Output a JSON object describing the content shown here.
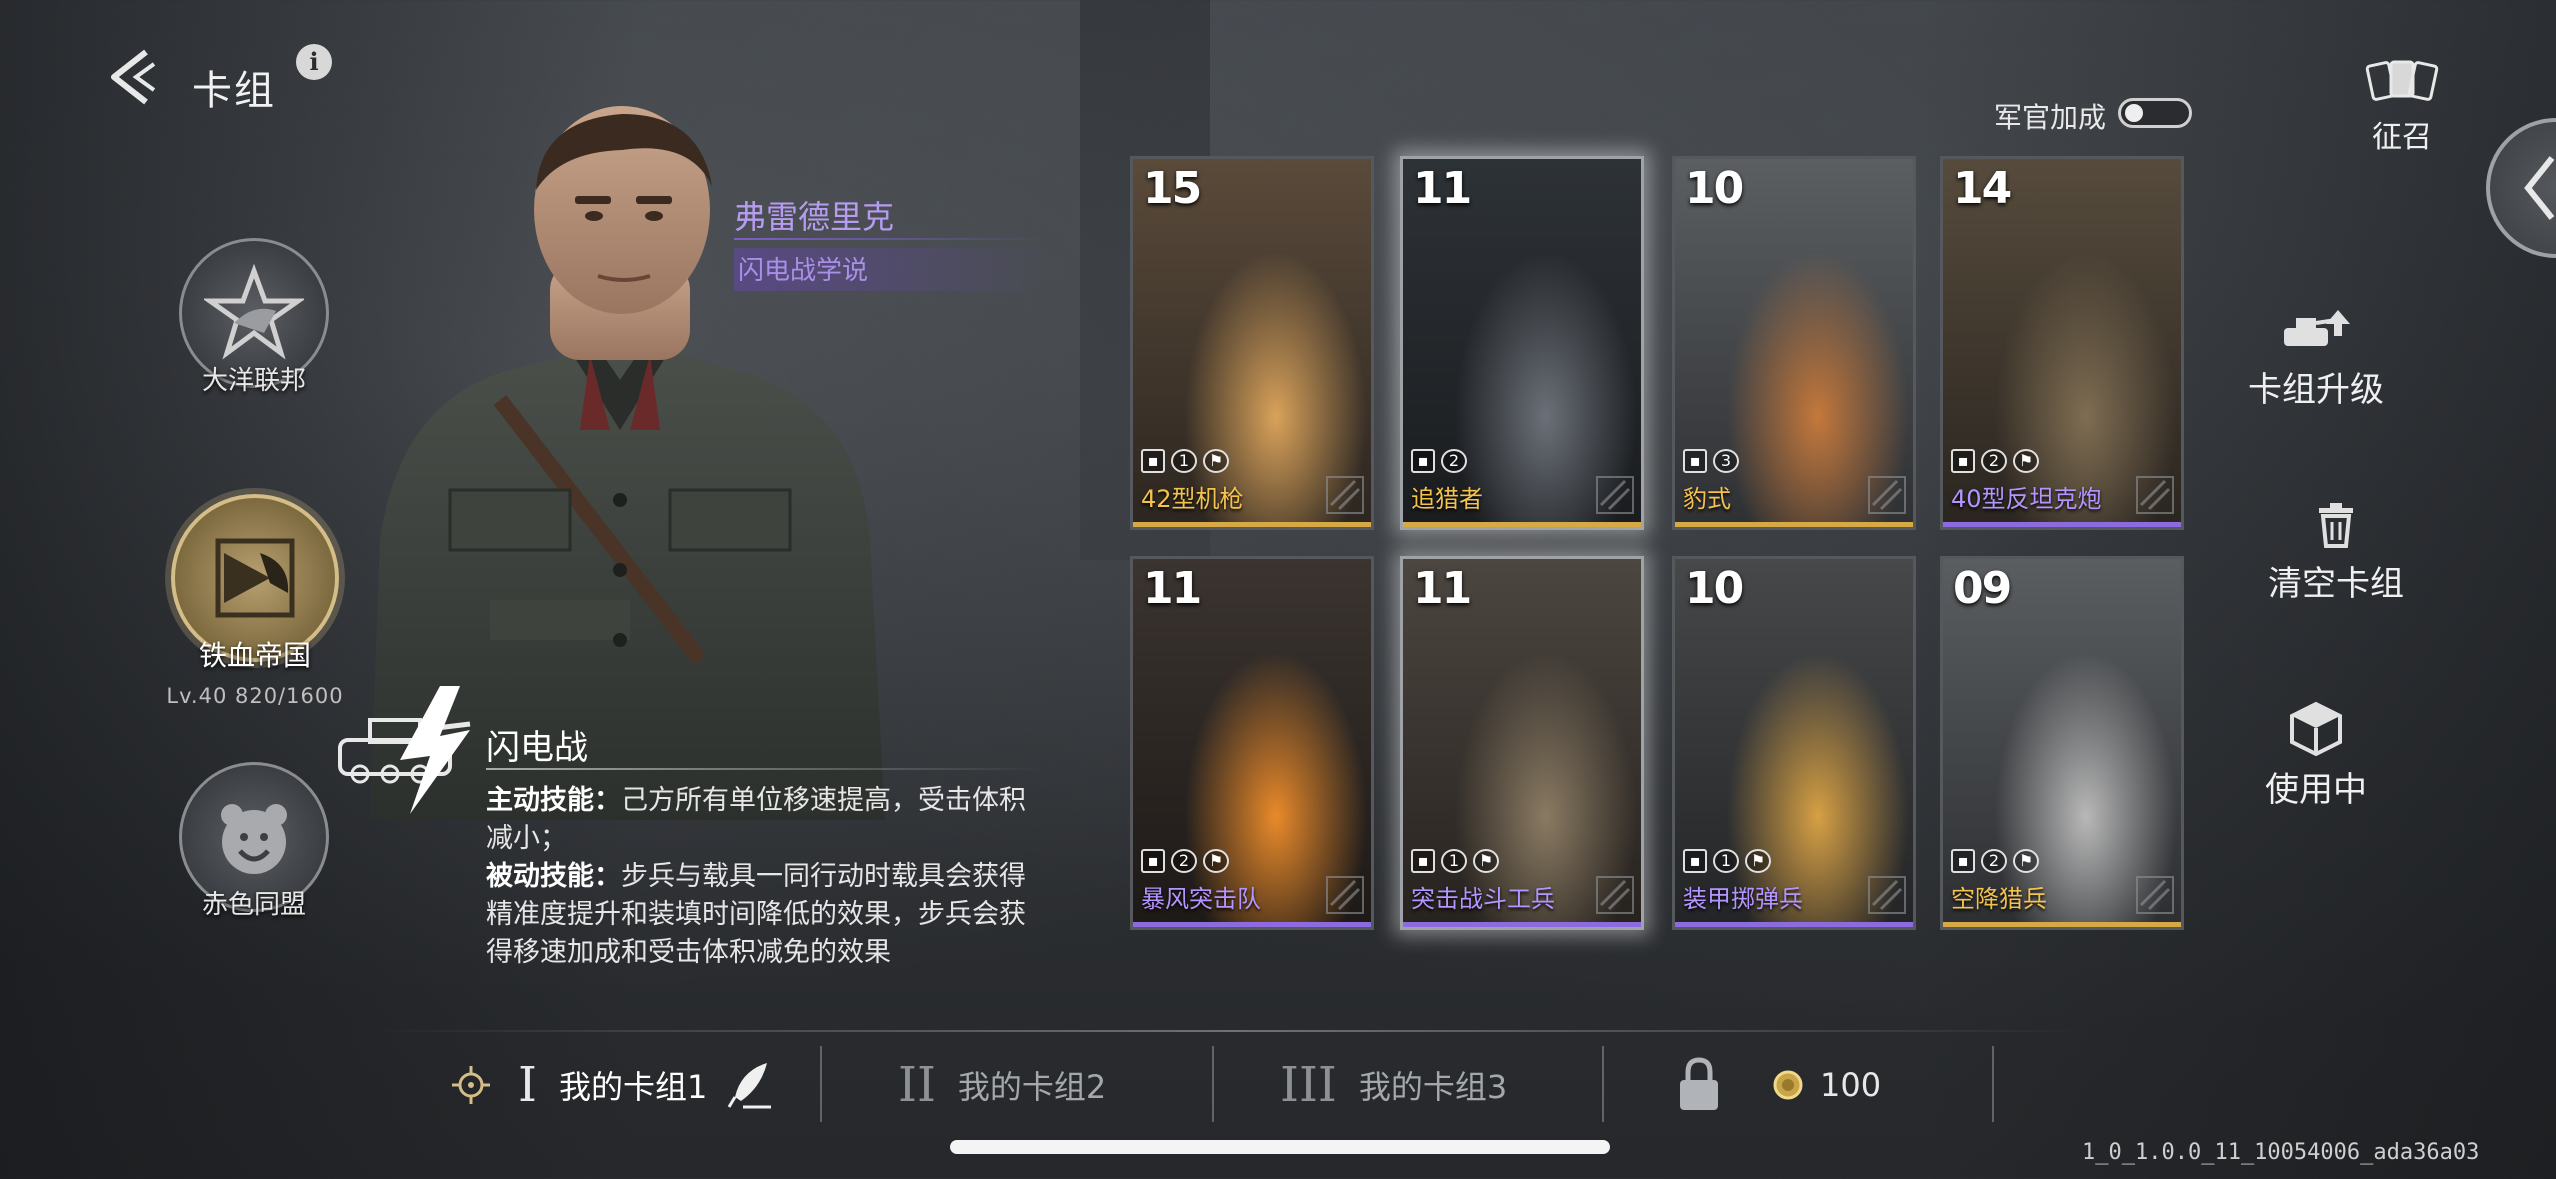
{
  "header": {
    "title": "卡组",
    "info_icon": "info-icon",
    "back_icon": "back-arrow-icon"
  },
  "factions": [
    {
      "name": "大洋联邦",
      "icon": "star-eagle-emblem-icon",
      "active": false
    },
    {
      "name": "铁血帝国",
      "icon": "iron-eagle-emblem-icon",
      "active": true,
      "level_text": "Lv.40  820/1600"
    },
    {
      "name": "赤色同盟",
      "icon": "bear-emblem-icon",
      "active": false
    }
  ],
  "commander": {
    "name": "弗雷德里克",
    "doctrine": "闪电战学说",
    "skill_name": "闪电战",
    "active_label": "主动技能：",
    "active_text": "己方所有单位移速提高，受击体积减小；",
    "passive_label": "被动技能：",
    "passive_text": "步兵与载具一同行动时载具会获得精准度提升和装填时间降低的效果，步兵会获得移速加成和受击体积减免的效果"
  },
  "officer_bonus": {
    "label": "军官加成",
    "enabled": false
  },
  "recruit": {
    "label": "征召"
  },
  "side_actions": {
    "upgrade": "卡组升级",
    "clear": "清空卡组",
    "in_use": "使用中"
  },
  "cards": [
    {
      "cost": "15",
      "name": "42型机枪",
      "rarity": "gold",
      "type_icon": "infantry-icon",
      "count": "1",
      "flag": true
    },
    {
      "cost": "11",
      "name": "追猎者",
      "rarity": "gold",
      "type_icon": "tank-destroyer-icon",
      "count": "2",
      "flag": false
    },
    {
      "cost": "10",
      "name": "豹式",
      "rarity": "gold",
      "type_icon": "tank-icon",
      "count": "3",
      "flag": false
    },
    {
      "cost": "14",
      "name": "40型反坦克炮",
      "rarity": "purple",
      "type_icon": "artillery-icon",
      "count": "2",
      "flag": true
    },
    {
      "cost": "11",
      "name": "暴风突击队",
      "rarity": "purple",
      "type_icon": "assault-icon",
      "count": "2",
      "flag": true
    },
    {
      "cost": "11",
      "name": "突击战斗工兵",
      "rarity": "purple",
      "type_icon": "engineer-icon",
      "count": "1",
      "flag": true
    },
    {
      "cost": "10",
      "name": "装甲掷弹兵",
      "rarity": "purple",
      "type_icon": "medic-cross-icon",
      "count": "1",
      "flag": true
    },
    {
      "cost": "09",
      "name": "空降猎兵",
      "rarity": "gold",
      "type_icon": "airborne-icon",
      "count": "2",
      "flag": true
    }
  ],
  "decks": [
    {
      "numeral": "I",
      "label": "我的卡组1",
      "active": true
    },
    {
      "numeral": "II",
      "label": "我的卡组2",
      "active": false
    },
    {
      "numeral": "III",
      "label": "我的卡组3",
      "active": false
    }
  ],
  "locked_slot": {
    "cost": "100"
  },
  "version": "1_0_1.0.0_11_10054006_ada36a03",
  "colors": {
    "gold": "#d6a944",
    "purple": "#8c6ae0",
    "commander_name": "#b69cf0"
  }
}
